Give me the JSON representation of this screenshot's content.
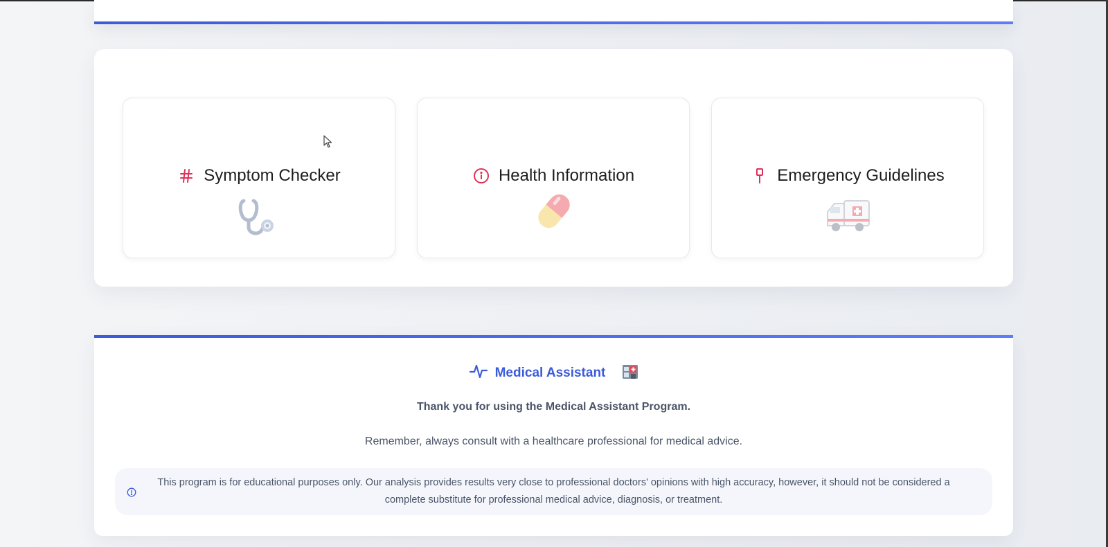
{
  "cards": [
    {
      "label": "Symptom Checker",
      "icon": "hash-icon",
      "deco": "stethoscope-icon"
    },
    {
      "label": "Health Information",
      "icon": "info-circle-icon",
      "deco": "pill-icon"
    },
    {
      "label": "Emergency Guidelines",
      "icon": "map-pin-icon",
      "deco": "ambulance-icon"
    }
  ],
  "footer": {
    "brand": "Medical Assistant",
    "brand_icon": "activity-icon",
    "brand_emoji": "hospital-emoji-icon",
    "thanks": "Thank you for using the Medical Assistant Program.",
    "remember": "Remember, always consult with a healthcare professional for medical advice.",
    "disclaimer": "This program is for educational purposes only. Our analysis provides results very close to professional doctors' opinions with high accuracy, however, it should not be considered a complete substitute for professional medical advice, diagnosis, or treatment."
  },
  "colors": {
    "accent": "#3b5bdb",
    "icon_red": "#e03157",
    "text_dark": "#1d1d1f",
    "text_muted": "#4a5568"
  }
}
